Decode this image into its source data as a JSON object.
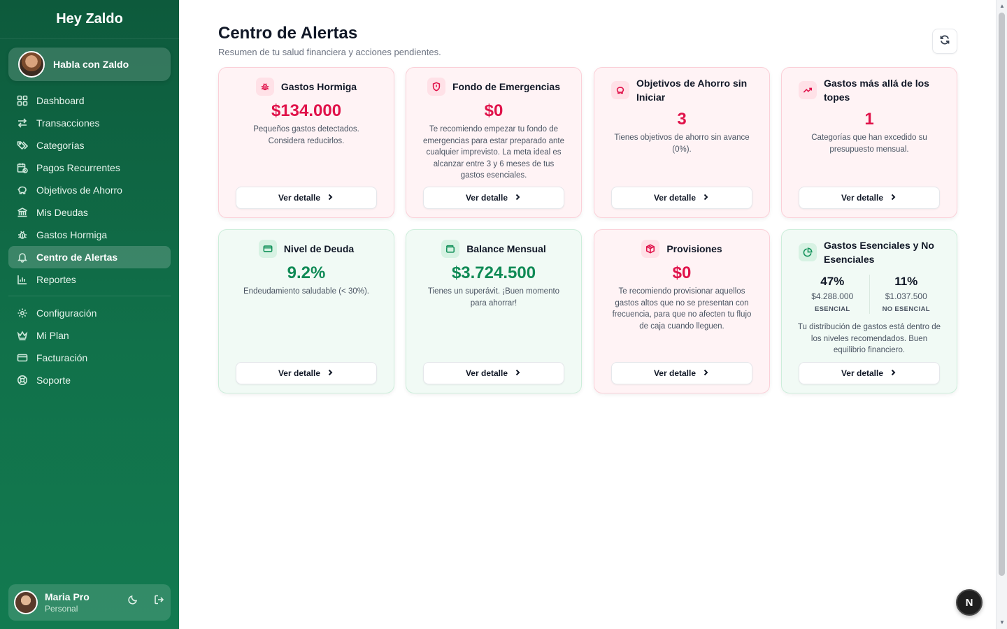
{
  "sidebar": {
    "brand": "Hey Zaldo",
    "chat_button": "Habla con Zaldo",
    "nav": [
      {
        "label": "Dashboard",
        "icon": "dashboard-icon"
      },
      {
        "label": "Transacciones",
        "icon": "transfer-icon"
      },
      {
        "label": "Categorías",
        "icon": "tags-icon"
      },
      {
        "label": "Pagos Recurrentes",
        "icon": "calendar-clock-icon"
      },
      {
        "label": "Objetivos de Ahorro",
        "icon": "piggy-bank-icon"
      },
      {
        "label": "Mis Deudas",
        "icon": "bank-icon"
      },
      {
        "label": "Gastos Hormiga",
        "icon": "bug-icon"
      },
      {
        "label": "Centro de Alertas",
        "icon": "bell-icon",
        "active": true
      },
      {
        "label": "Reportes",
        "icon": "bar-chart-icon"
      }
    ],
    "nav_secondary": [
      {
        "label": "Configuración",
        "icon": "gear-icon"
      },
      {
        "label": "Mi Plan",
        "icon": "crown-icon"
      },
      {
        "label": "Facturación",
        "icon": "credit-card-icon"
      },
      {
        "label": "Soporte",
        "icon": "lifebuoy-icon"
      }
    ],
    "user": {
      "name": "Maria Pro",
      "plan": "Personal"
    }
  },
  "header": {
    "title": "Centro de Alertas",
    "subtitle": "Resumen de tu salud financiera y acciones pendientes."
  },
  "button_label": "Ver detalle",
  "cards": [
    {
      "title": "Gastos Hormiga",
      "value": "$134.000",
      "desc": "Pequeños gastos detectados. Considera reducirlos.",
      "tone": "red",
      "icon": "bug-icon"
    },
    {
      "title": "Fondo de Emergencias",
      "value": "$0",
      "desc": "Te recomiendo empezar tu fondo de emergencias para estar preparado ante cualquier imprevisto. La meta ideal es alcanzar entre 3 y 6 meses de tus gastos esenciales.",
      "tone": "red",
      "icon": "shield-icon"
    },
    {
      "title": "Objetivos de Ahorro sin Iniciar",
      "value": "3",
      "desc": "Tienes objetivos de ahorro sin avance (0%).",
      "tone": "red",
      "icon": "piggy-bank-icon"
    },
    {
      "title": "Gastos más allá de los topes",
      "value": "1",
      "desc": "Categorías que han excedido su presupuesto mensual.",
      "tone": "red",
      "icon": "trending-up-icon"
    },
    {
      "title": "Nivel de Deuda",
      "value": "9.2%",
      "desc": "Endeudamiento saludable (< 30%).",
      "tone": "green",
      "icon": "credit-card-icon"
    },
    {
      "title": "Balance Mensual",
      "value": "$3.724.500",
      "desc": "Tienes un superávit. ¡Buen momento para ahorrar!",
      "tone": "green",
      "icon": "wallet-icon"
    },
    {
      "title": "Provisiones",
      "value": "$0",
      "desc": "Te recomiendo provisionar aquellos gastos altos que no se presentan con frecuencia, para que no afecten tu flujo de caja cuando lleguen.",
      "tone": "red",
      "icon": "package-icon"
    },
    {
      "title": "Gastos Esenciales y No Esenciales",
      "desc": "Tu distribución de gastos está dentro de los niveles recomendados. Buen equilibrio financiero.",
      "tone": "green",
      "icon": "pie-chart-icon",
      "essential": {
        "pct": "47%",
        "amount": "$4.288.000",
        "label": "ESENCIAL"
      },
      "non_essential": {
        "pct": "11%",
        "amount": "$1.037.500",
        "label": "NO ESENCIAL"
      }
    }
  ],
  "floating_badge": "N",
  "colors": {
    "sidebar": "#0d5a3c",
    "alert_red": "#e0124a",
    "success_green": "#0f8a55"
  }
}
